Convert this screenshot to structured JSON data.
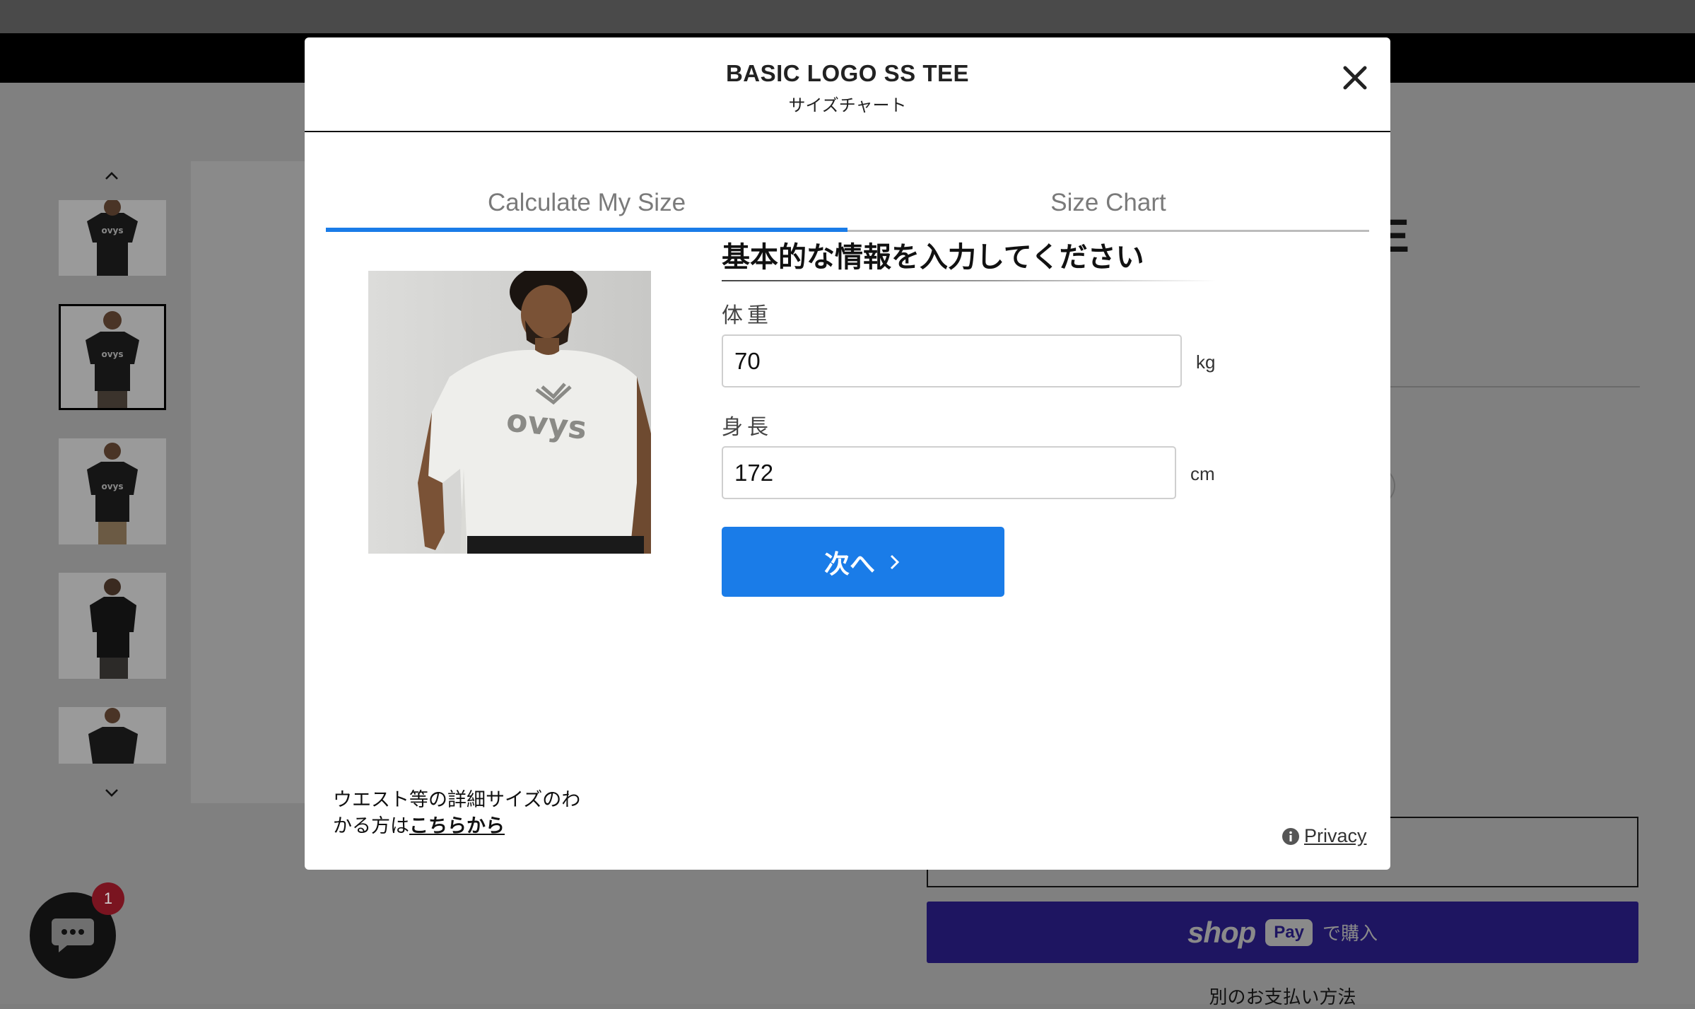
{
  "modal": {
    "title": "BASIC LOGO SS TEE",
    "subtitle": "サイズチャート",
    "tabs": [
      {
        "label": "Calculate My Size",
        "active": true
      },
      {
        "label": "Size Chart",
        "active": false
      }
    ],
    "form": {
      "heading": "基本的な情報を入力してください",
      "weight": {
        "label": "体重",
        "value": "70",
        "unit": "kg"
      },
      "height": {
        "label": "身長",
        "value": "172",
        "unit": "cm"
      },
      "next_label": "次へ"
    },
    "footer": {
      "note": "ウエスト等の詳細サイズのわかる方は",
      "link": "こちらから",
      "privacy": "Privacy"
    },
    "accent_color": "#1a7ce8",
    "product_logo_text": "ovys"
  },
  "background": {
    "title_fragment": "E",
    "shop_pay": {
      "logo": "shop",
      "badge": "Pay",
      "suffix": "で購入"
    },
    "other_payment": "別のお支払い方法",
    "cart_badge_count": "1"
  }
}
